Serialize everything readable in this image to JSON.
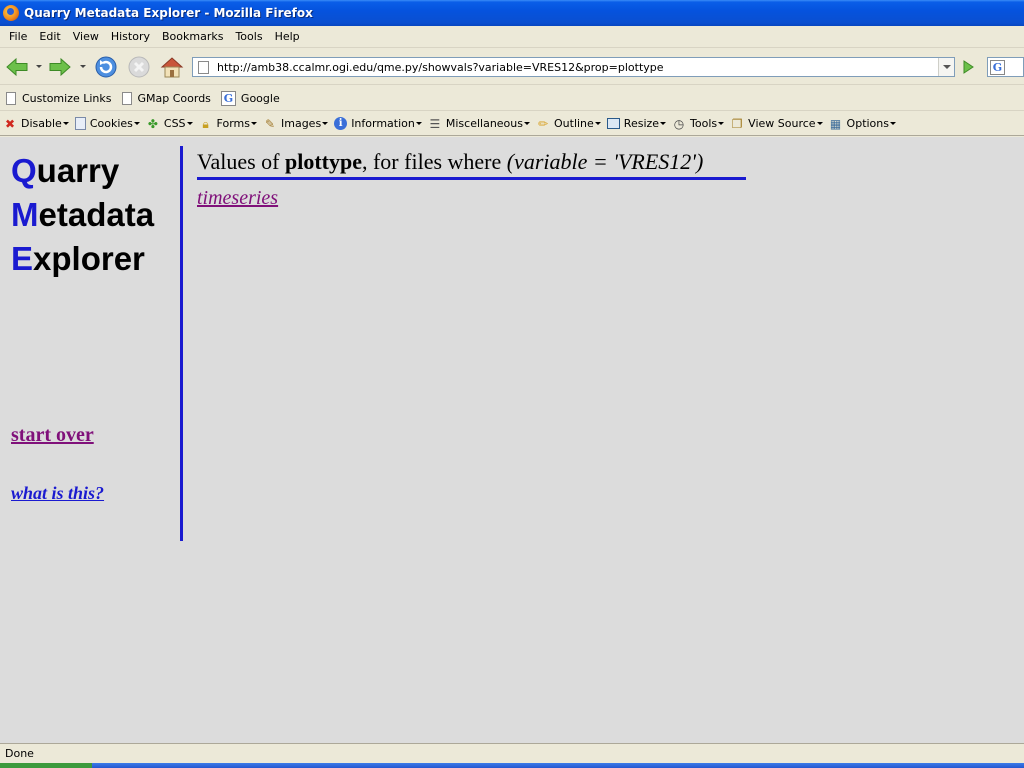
{
  "window": {
    "title": "Quarry Metadata Explorer - Mozilla Firefox"
  },
  "menu": [
    "File",
    "Edit",
    "View",
    "History",
    "Bookmarks",
    "Tools",
    "Help"
  ],
  "address": {
    "url": "http://amb38.ccalmr.ogi.edu/qme.py/showvals?variable=VRES12&prop=plottype"
  },
  "search": {
    "engine_letter": "G"
  },
  "bookmarks": [
    {
      "label": "Customize Links",
      "icon": "page-icon"
    },
    {
      "label": "GMap Coords",
      "icon": "page-icon"
    },
    {
      "label": "Google",
      "icon": "google-icon"
    }
  ],
  "devtoolbar": [
    {
      "label": "Disable",
      "icon": "disable-icon"
    },
    {
      "label": "Cookies",
      "icon": "cookies-icon"
    },
    {
      "label": "CSS",
      "icon": "css-icon"
    },
    {
      "label": "Forms",
      "icon": "forms-icon"
    },
    {
      "label": "Images",
      "icon": "images-icon"
    },
    {
      "label": "Information",
      "icon": "information-icon"
    },
    {
      "label": "Miscellaneous",
      "icon": "miscellaneous-icon"
    },
    {
      "label": "Outline",
      "icon": "outline-icon"
    },
    {
      "label": "Resize",
      "icon": "resize-icon"
    },
    {
      "label": "Tools",
      "icon": "tools-icon"
    },
    {
      "label": "View Source",
      "icon": "view-source-icon"
    },
    {
      "label": "Options",
      "icon": "options-icon"
    }
  ],
  "page": {
    "app_title": {
      "line1_initial": "Q",
      "line1_rest": "uarry",
      "line2_initial": "M",
      "line2_rest": "etadata",
      "line3_initial": "E",
      "line3_rest": "xplorer"
    },
    "start_over": "start over",
    "what_is_this": "what is this?",
    "heading": {
      "prefix": "Values of ",
      "property": "plottype",
      "middle": ", for files where ",
      "condition": "(variable = 'VRES12')"
    },
    "values": [
      "timeseries"
    ]
  },
  "status": {
    "text": "Done"
  },
  "colors": {
    "accent_blue": "#1a1ad0",
    "visited_link": "#80107a",
    "content_bg": "#dcdcdc",
    "chrome_bg": "#ece9d8"
  }
}
